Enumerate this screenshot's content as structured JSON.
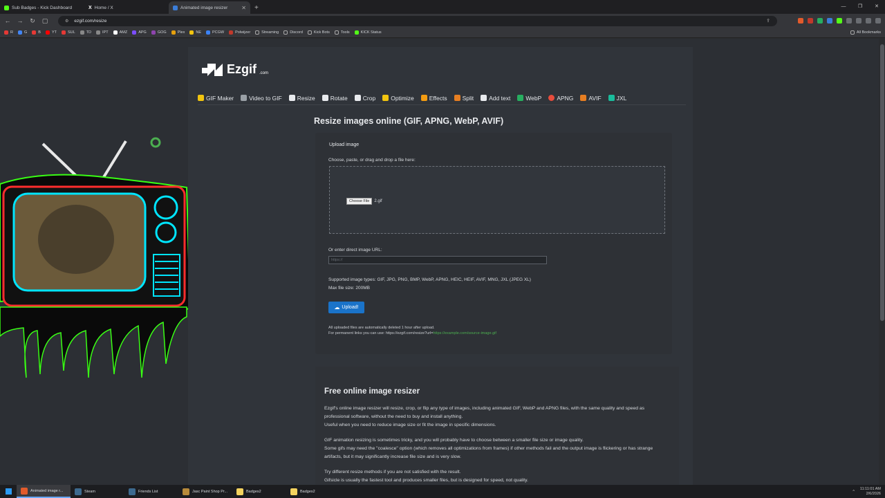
{
  "tabs": [
    {
      "title": "Sub Badges - Kick Dashboard",
      "color": "#53fc18"
    },
    {
      "title": "Home / X",
      "color": "#ffffff"
    },
    {
      "title": "Animated image resizer",
      "color": "#3b7dd8",
      "active": true
    }
  ],
  "address": {
    "url": "ezgif.com/resize"
  },
  "bookmarks": [
    {
      "label": "R",
      "color": "#e53935"
    },
    {
      "label": "G",
      "color": "#4285f4"
    },
    {
      "label": "B",
      "color": "#e53935"
    },
    {
      "label": "YT",
      "color": "#ff0000"
    },
    {
      "label": "SUL",
      "color": "#e53935"
    },
    {
      "label": "TD",
      "color": "#888888"
    },
    {
      "label": "IPT",
      "color": "#888888"
    },
    {
      "label": "AMZ",
      "color": "#ffffff"
    },
    {
      "label": "APG",
      "color": "#7c4dff"
    },
    {
      "label": "GOG",
      "color": "#8e44ad"
    },
    {
      "label": "Plex",
      "color": "#e5a00d"
    },
    {
      "label": "NE",
      "color": "#f1c40f"
    },
    {
      "label": "PCGW",
      "color": "#3b82f6"
    },
    {
      "label": "Polwijzer",
      "color": "#c0392b"
    },
    {
      "label": "Streaming",
      "color": "#888888"
    },
    {
      "label": "Discord",
      "color": "#888888"
    },
    {
      "label": "Kick Bots",
      "color": "#888888"
    },
    {
      "label": "Tools",
      "color": "#888888"
    },
    {
      "label": "KICK Status",
      "color": "#53fc18"
    }
  ],
  "all_bookmarks": "All Bookmarks",
  "site": {
    "logo": "Ezgif",
    "logo_suffix": ".com",
    "nav": [
      {
        "label": "GIF Maker",
        "color": "#f1c40f"
      },
      {
        "label": "Video to GIF",
        "color": "#9aa0a6"
      },
      {
        "label": "Resize",
        "color": "#e8eaed"
      },
      {
        "label": "Rotate",
        "color": "#e8eaed"
      },
      {
        "label": "Crop",
        "color": "#e8eaed"
      },
      {
        "label": "Optimize",
        "color": "#f1c40f"
      },
      {
        "label": "Effects",
        "color": "#f39c12"
      },
      {
        "label": "Split",
        "color": "#e67e22"
      },
      {
        "label": "Add text",
        "color": "#e8eaed"
      },
      {
        "label": "WebP",
        "color": "#27ae60"
      },
      {
        "label": "APNG",
        "color": "#e74c3c"
      },
      {
        "label": "AVIF",
        "color": "#e67e22"
      },
      {
        "label": "JXL",
        "color": "#1abc9c"
      }
    ],
    "heading": "Resize images online (GIF, APNG, WebP, AVIF)",
    "upload": {
      "title": "Upload image",
      "instruction": "Choose, paste, or drag and drop a file here:",
      "choose_label": "Choose File",
      "file_name": "2.gif",
      "url_label": "Or enter direct image URL:",
      "url_placeholder": "https://",
      "supported": "Supported image types: GIF, JPG, PNG, BMP, WebP, APNG, HEIC, HEIF, AVIF, MNG, JXL (JPEG XL)",
      "max_size": "Max file size: 200MB",
      "button": "Upload!",
      "note1": "All uploaded files are automatically deleted 1 hour after upload.",
      "note2_prefix": "For permanent links you can use: https://ezgif.com/resize?url=",
      "note2_link": "https://example.com/source-image.gif"
    },
    "info": {
      "title": "Free online image resizer",
      "p1": "Ezgif's online image resizer will resize, crop, or flip any type of images, including animated GIF, WebP and APNG files, with the same quality and speed as professional software, without the need to buy and install anything.",
      "p1b": "Useful when you need to reduce image size or fit the image in specific dimensions.",
      "p2": "GIF animation resizing is sometimes tricky, and you will probably have to choose between a smaller file size or image quality.",
      "p2b": "Some gifs may need the \"coalesce\" option (which removes all optimizations from frames) if other methods fail and the output image is flickering or has strange artifacts, but it may significantly increase file size and is very slow.",
      "p3": "Try different resize methods if you are not satisfied with the result.",
      "p3b": "Gifsicle is usually the fastest tool and produces smaller files, but is designed for speed, not quality."
    }
  },
  "taskbar": [
    {
      "label": "Animated image r...",
      "color": "#e25b2c",
      "active": true
    },
    {
      "label": "Steam",
      "color": "#1b2838"
    },
    {
      "label": "Friends List",
      "color": "#1b2838"
    },
    {
      "label": "Jasc Paint Shop Pr...",
      "color": "#b78a3a"
    },
    {
      "label": "Badges2",
      "color": "#f4d35e"
    },
    {
      "label": "Badges2",
      "color": "#f4d35e"
    }
  ],
  "clock": {
    "time": "11:11:01 AM",
    "date": "2/6/2026"
  }
}
